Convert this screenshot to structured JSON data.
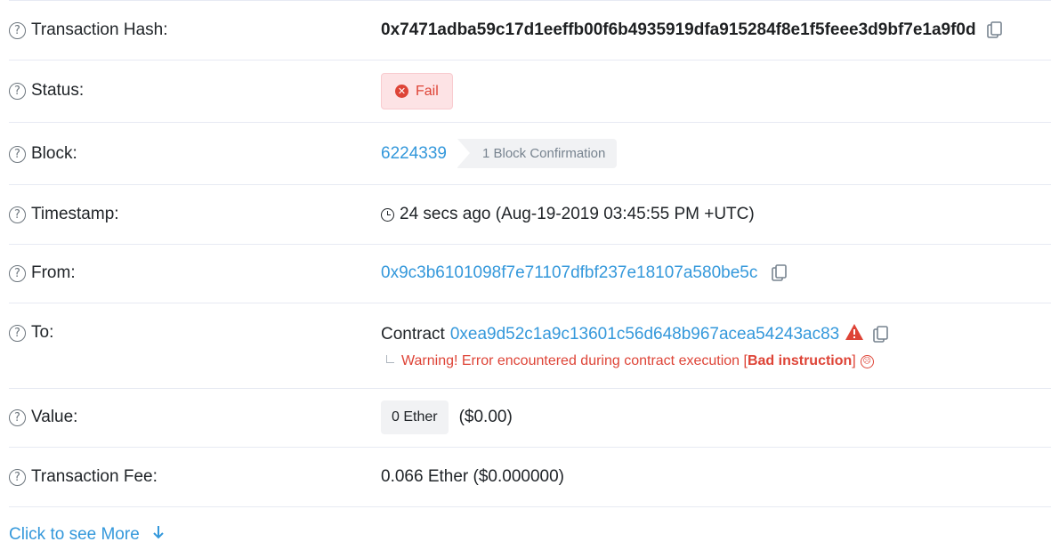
{
  "rows": {
    "tx_hash": {
      "label": "Transaction Hash:",
      "value": "0x7471adba59c17d1eeffb00f6b4935919dfa915284f8e1f5feee3d9bf7e1a9f0d"
    },
    "status": {
      "label": "Status:",
      "value": "Fail"
    },
    "block": {
      "label": "Block:",
      "number": "6224339",
      "confirmation": "1 Block Confirmation"
    },
    "timestamp": {
      "label": "Timestamp:",
      "value": "24 secs ago (Aug-19-2019 03:45:55 PM +UTC)"
    },
    "from": {
      "label": "From:",
      "value": "0x9c3b6101098f7e71107dfbf237e18107a580be5c"
    },
    "to": {
      "label": "To:",
      "prefix": "Contract",
      "address": "0xea9d52c1a9c13601c56d648b967acea54243ac83",
      "warning_title": "Warning!",
      "warning_text": " Error encountered during contract execution [",
      "warning_bold": "Bad instruction",
      "warning_end": "]"
    },
    "value": {
      "label": "Value:",
      "ether": "0 Ether",
      "usd": "($0.00)"
    },
    "fee": {
      "label": "Transaction Fee:",
      "value": "0.066 Ether ($0.000000)"
    }
  },
  "more_link": "Click to see More",
  "colors": {
    "link": "#3498db",
    "danger": "#de4437",
    "muted": "#77838f",
    "border": "#e7eaf3"
  },
  "icons": [
    "question-icon",
    "copy-icon",
    "x-circle-icon",
    "clock-icon",
    "warning-icon",
    "frown-icon",
    "arrow-down-icon"
  ]
}
